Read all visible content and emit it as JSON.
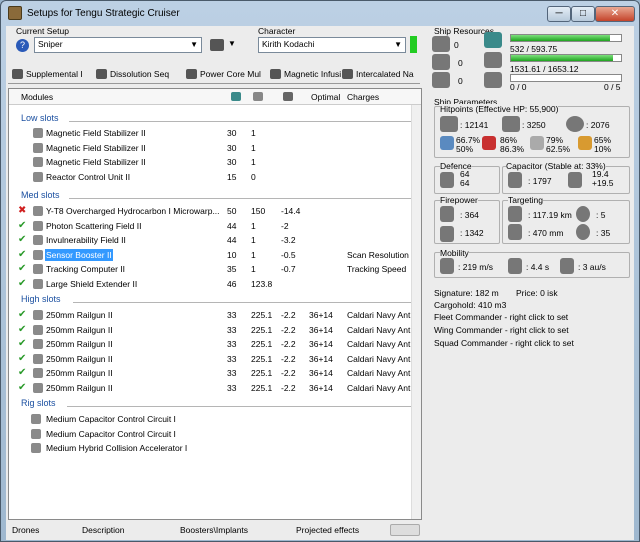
{
  "window": {
    "title": "Setups for Tengu Strategic Cruiser",
    "min": "─",
    "max": "□",
    "close": "✕"
  },
  "setup": {
    "label": "Current Setup",
    "value": "Sniper",
    "character_label": "Character",
    "character_value": "Kirith Kodachi"
  },
  "tabs": [
    "Supplemental I",
    "Dissolution Seq",
    "Power Core Mul",
    "Magnetic Infusi",
    "Intercalated Na"
  ],
  "table": {
    "headers": {
      "modules": "Modules",
      "optimal": "Optimal",
      "charges": "Charges"
    },
    "sections": {
      "low": "Low slots",
      "med": "Med slots",
      "high": "High slots",
      "rig": "Rig slots"
    },
    "low": [
      {
        "name": "Magnetic Field Stabilizer II",
        "c1": "30",
        "c2": "1",
        "c3": "",
        "opt": "",
        "chg": ""
      },
      {
        "name": "Magnetic Field Stabilizer II",
        "c1": "30",
        "c2": "1",
        "c3": "",
        "opt": "",
        "chg": ""
      },
      {
        "name": "Magnetic Field Stabilizer II",
        "c1": "30",
        "c2": "1",
        "c3": "",
        "opt": "",
        "chg": ""
      },
      {
        "name": "Reactor Control Unit II",
        "c1": "15",
        "c2": "0",
        "c3": "",
        "opt": "",
        "chg": ""
      }
    ],
    "med": [
      {
        "name": "Y-T8 Overcharged Hydrocarbon I Microwarp...",
        "c1": "50",
        "c2": "150",
        "c3": "-14.4",
        "opt": "",
        "chg": "",
        "status": "x"
      },
      {
        "name": "Photon Scattering Field II",
        "c1": "44",
        "c2": "1",
        "c3": "-2",
        "opt": "",
        "chg": "",
        "status": "ok"
      },
      {
        "name": "Invulnerability Field II",
        "c1": "44",
        "c2": "1",
        "c3": "-3.2",
        "opt": "",
        "chg": "",
        "status": "ok"
      },
      {
        "name": "Sensor Booster II",
        "c1": "10",
        "c2": "1",
        "c3": "-0.5",
        "opt": "",
        "chg": "Scan Resolution",
        "status": "ok"
      },
      {
        "name": "Tracking Computer II",
        "c1": "35",
        "c2": "1",
        "c3": "-0.7",
        "opt": "",
        "chg": "Tracking Speed",
        "status": "ok"
      },
      {
        "name": "Large Shield Extender II",
        "c1": "46",
        "c2": "123.8",
        "c3": "",
        "opt": "",
        "chg": "",
        "status": "ok"
      }
    ],
    "high": [
      {
        "name": "250mm Railgun II",
        "c1": "33",
        "c2": "225.1",
        "c3": "-2.2",
        "opt": "36+14",
        "chg": "Caldari Navy Ant..."
      },
      {
        "name": "250mm Railgun II",
        "c1": "33",
        "c2": "225.1",
        "c3": "-2.2",
        "opt": "36+14",
        "chg": "Caldari Navy Ant..."
      },
      {
        "name": "250mm Railgun II",
        "c1": "33",
        "c2": "225.1",
        "c3": "-2.2",
        "opt": "36+14",
        "chg": "Caldari Navy Ant..."
      },
      {
        "name": "250mm Railgun II",
        "c1": "33",
        "c2": "225.1",
        "c3": "-2.2",
        "opt": "36+14",
        "chg": "Caldari Navy Ant..."
      },
      {
        "name": "250mm Railgun II",
        "c1": "33",
        "c2": "225.1",
        "c3": "-2.2",
        "opt": "36+14",
        "chg": "Caldari Navy Ant..."
      },
      {
        "name": "250mm Railgun II",
        "c1": "33",
        "c2": "225.1",
        "c3": "-2.2",
        "opt": "36+14",
        "chg": "Caldari Navy Ant..."
      }
    ],
    "rig": [
      {
        "name": "Medium Capacitor Control Circuit I"
      },
      {
        "name": "Medium Capacitor Control Circuit I"
      },
      {
        "name": "Medium Hybrid Collision Accelerator I"
      }
    ]
  },
  "bottom_tabs": [
    "Drones",
    "Description",
    "Boosters\\Implants",
    "Projected effects"
  ],
  "resources": {
    "title": "Ship Resources",
    "slots": [
      "0",
      "0",
      "0"
    ],
    "cpu": "532 / 593.75",
    "cpu_frac": 0.896,
    "power": "1531.61 / 1653.12",
    "power_frac": 0.926,
    "drone": "0 / 0",
    "drone2": "0 / 5"
  },
  "params": {
    "title": "Ship Parameters",
    "hitpoints": "Hitpoints (Effective HP: 55,900)",
    "shield_hp": ": 12141",
    "armor_hp": ": 3250",
    "hull_hp": ": 2076",
    "res": [
      [
        "66.7%",
        "50%"
      ],
      [
        "86%",
        "86.3%"
      ],
      [
        "79%",
        "62.5%"
      ],
      [
        "65%",
        "10%"
      ]
    ],
    "defence": "Defence",
    "def_a": "64",
    "def_b": "64",
    "capacitor": "Capacitor (Stable at: 33%)",
    "cap_val": ": 1797",
    "cap_a": "19.4",
    "cap_b": "+19.5",
    "firepower": "Firepower",
    "fp_a": ": 364",
    "fp_b": ": 1342",
    "targeting": "Targeting",
    "range": ": 117.19 km",
    "targets": ": 5",
    "scan": ": 470 mm",
    "sig_res": ": 35",
    "mobility": "Mobility",
    "speed": ": 219 m/s",
    "align": ": 4.4 s",
    "warp": ": 3 au/s",
    "signature": "Signature: 182 m",
    "price": "Price: 0 isk",
    "cargo": "Cargohold: 410 m3",
    "fleet": "Fleet Commander - right click to set",
    "wing": "Wing Commander - right click to set",
    "squad": "Squad Commander - right click to set"
  }
}
